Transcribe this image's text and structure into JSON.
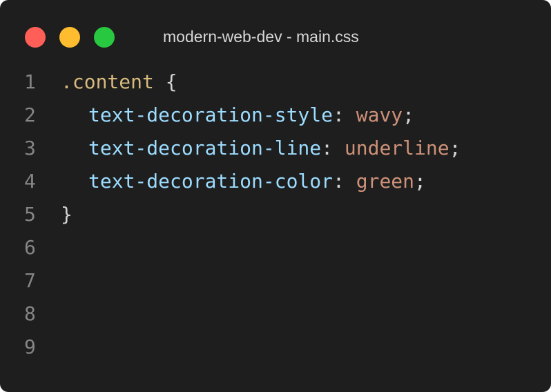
{
  "window": {
    "title": "modern-web-dev - main.css",
    "traffic_lights": [
      {
        "name": "close",
        "color": "#ff5f57"
      },
      {
        "name": "minimize",
        "color": "#febc2e"
      },
      {
        "name": "zoom",
        "color": "#28c840"
      }
    ],
    "background": "#1e1e1f"
  },
  "editor": {
    "colors": {
      "line_number": "#858585",
      "selector": "#d7ba7d",
      "property": "#9cdcfe",
      "value": "#ce9178",
      "punctuation": "#d4d4d4"
    },
    "lines": [
      {
        "number": "1",
        "selector": ".content",
        "brace": "{"
      },
      {
        "number": "2",
        "property": "text-decoration-style",
        "colon": ":",
        "value": "wavy",
        "semicolon": ";"
      },
      {
        "number": "3",
        "property": "text-decoration-line",
        "colon": ":",
        "value": "underline",
        "semicolon": ";"
      },
      {
        "number": "4",
        "property": "text-decoration-color",
        "colon": ":",
        "value": "green",
        "semicolon": ";"
      },
      {
        "number": "5",
        "brace": "}"
      },
      {
        "number": "6"
      },
      {
        "number": "7"
      },
      {
        "number": "8"
      },
      {
        "number": "9"
      }
    ]
  }
}
